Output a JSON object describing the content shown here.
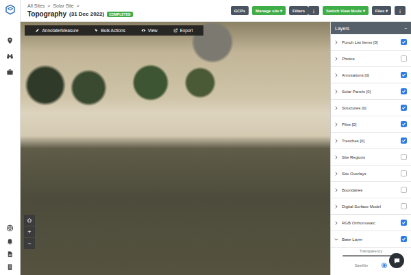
{
  "breadcrumb": [
    {
      "label": "All Sites",
      "sep": ">"
    },
    {
      "label": "Solar Site",
      "sep": ">"
    }
  ],
  "title": "Topography",
  "date": "(31 Dec 2022)",
  "status": "COMPLETED",
  "header_buttons": [
    {
      "label": "GCPs",
      "kind": "grey"
    },
    {
      "label": "Manage site ▾",
      "kind": "green"
    },
    {
      "label": "Filters",
      "kind": "grey"
    },
    {
      "label": "⋮",
      "kind": "grey"
    },
    {
      "label": "Switch View Mode ▾",
      "kind": "green"
    },
    {
      "label": "Files ▾",
      "kind": "grey"
    },
    {
      "label": "⋮",
      "kind": "grey"
    }
  ],
  "toolbar": [
    {
      "label": "Annotate/Measure"
    },
    {
      "label": "Bulk Actions"
    },
    {
      "label": "View"
    },
    {
      "label": "Export"
    }
  ],
  "map_controls": [
    "+",
    "−"
  ],
  "layers": {
    "title": "Layers",
    "collapse": "−",
    "items": [
      {
        "label": "Punch List Items [0]",
        "checked": true,
        "expanded": false
      },
      {
        "label": "Photos",
        "checked": false,
        "expanded": false
      },
      {
        "label": "Annotations [0]",
        "checked": true,
        "expanded": false
      },
      {
        "label": "Solar Panels [0]",
        "checked": true,
        "expanded": false
      },
      {
        "label": "Structures [0]",
        "checked": true,
        "expanded": false
      },
      {
        "label": "Piles [0]",
        "checked": true,
        "expanded": false
      },
      {
        "label": "Trenches [0]",
        "checked": true,
        "expanded": false
      },
      {
        "label": "Site Regions",
        "checked": false,
        "expanded": false
      },
      {
        "label": "Site Overlays",
        "checked": false,
        "expanded": false
      },
      {
        "label": "Boundaries",
        "checked": false,
        "expanded": false
      },
      {
        "label": "Digital Surface Model",
        "checked": false,
        "expanded": false
      },
      {
        "label": "RGB Orthomosaic",
        "checked": true,
        "expanded": false
      },
      {
        "label": "Base Layer",
        "checked": true,
        "expanded": true
      }
    ],
    "base_layer": {
      "transparency": {
        "label": "Transparency",
        "level": 0.9
      },
      "options": [
        {
          "label": "Satellite",
          "selected": true
        }
      ]
    }
  }
}
